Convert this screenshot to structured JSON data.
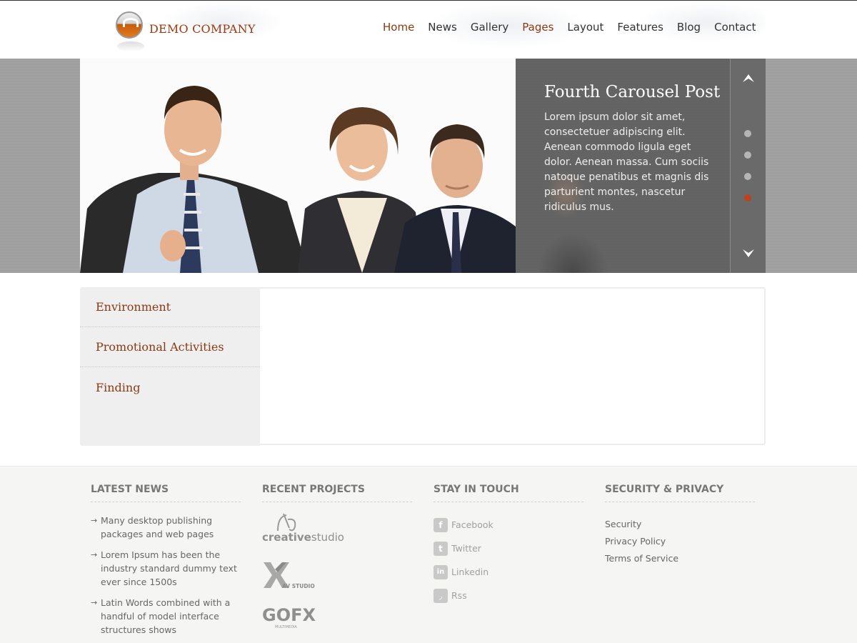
{
  "brand": {
    "name": "DEMO COMPANY"
  },
  "nav": {
    "items": [
      "Home",
      "News",
      "Gallery",
      "Pages",
      "Layout",
      "Features",
      "Blog",
      "Contact"
    ]
  },
  "slider": {
    "title": "Fourth Carousel Post",
    "text": "Lorem ipsum dolor sit amet, consectetuer adipiscing elit. Aenean commodo ligula eget dolor. Aenean massa. Cum sociis natoque penatibus et magnis dis parturient montes, nascetur ridiculus mus.",
    "slide_count": 4,
    "active_slide": 4
  },
  "tabs": {
    "items": [
      "Environment",
      "Promotional Activities",
      "Finding"
    ]
  },
  "footer": {
    "latest_news": {
      "title": "LATEST NEWS",
      "items": [
        "Many desktop publishing packages and web pages",
        "Lorem Ipsum has been the industry standard dummy text ever since 1500s",
        "Latin Words combined with a handful of model interface structures shows"
      ]
    },
    "recent_projects": {
      "title": "RECENT PROJECTS",
      "logos": [
        {
          "name": "creativestudio",
          "text_a": "creative",
          "text_b": "studio"
        },
        {
          "name": "AV STUDIO",
          "text": "AV STUDIO"
        },
        {
          "name": "GOFX",
          "text": "GOFX",
          "subtext": "MULTIMEDIA"
        }
      ]
    },
    "stay_in_touch": {
      "title": "STAY IN TOUCH",
      "links": [
        {
          "label": "Facebook",
          "icon": "facebook-icon",
          "glyph": "f"
        },
        {
          "label": "Twitter",
          "icon": "twitter-icon",
          "glyph": "t"
        },
        {
          "label": "Linkedin",
          "icon": "linkedin-icon",
          "glyph": "in"
        },
        {
          "label": "Rss",
          "icon": "rss-icon",
          "glyph": "◞"
        }
      ]
    },
    "security": {
      "title": "SECURITY & PRIVACY",
      "links": [
        "Security",
        "Privacy Policy",
        "Terms of Service"
      ]
    }
  },
  "colors": {
    "accent": "#8a3a12",
    "active_dot": "#c0421c",
    "caption_bg": "#5f5f5f",
    "footer_bg": "#f5f5f3"
  }
}
